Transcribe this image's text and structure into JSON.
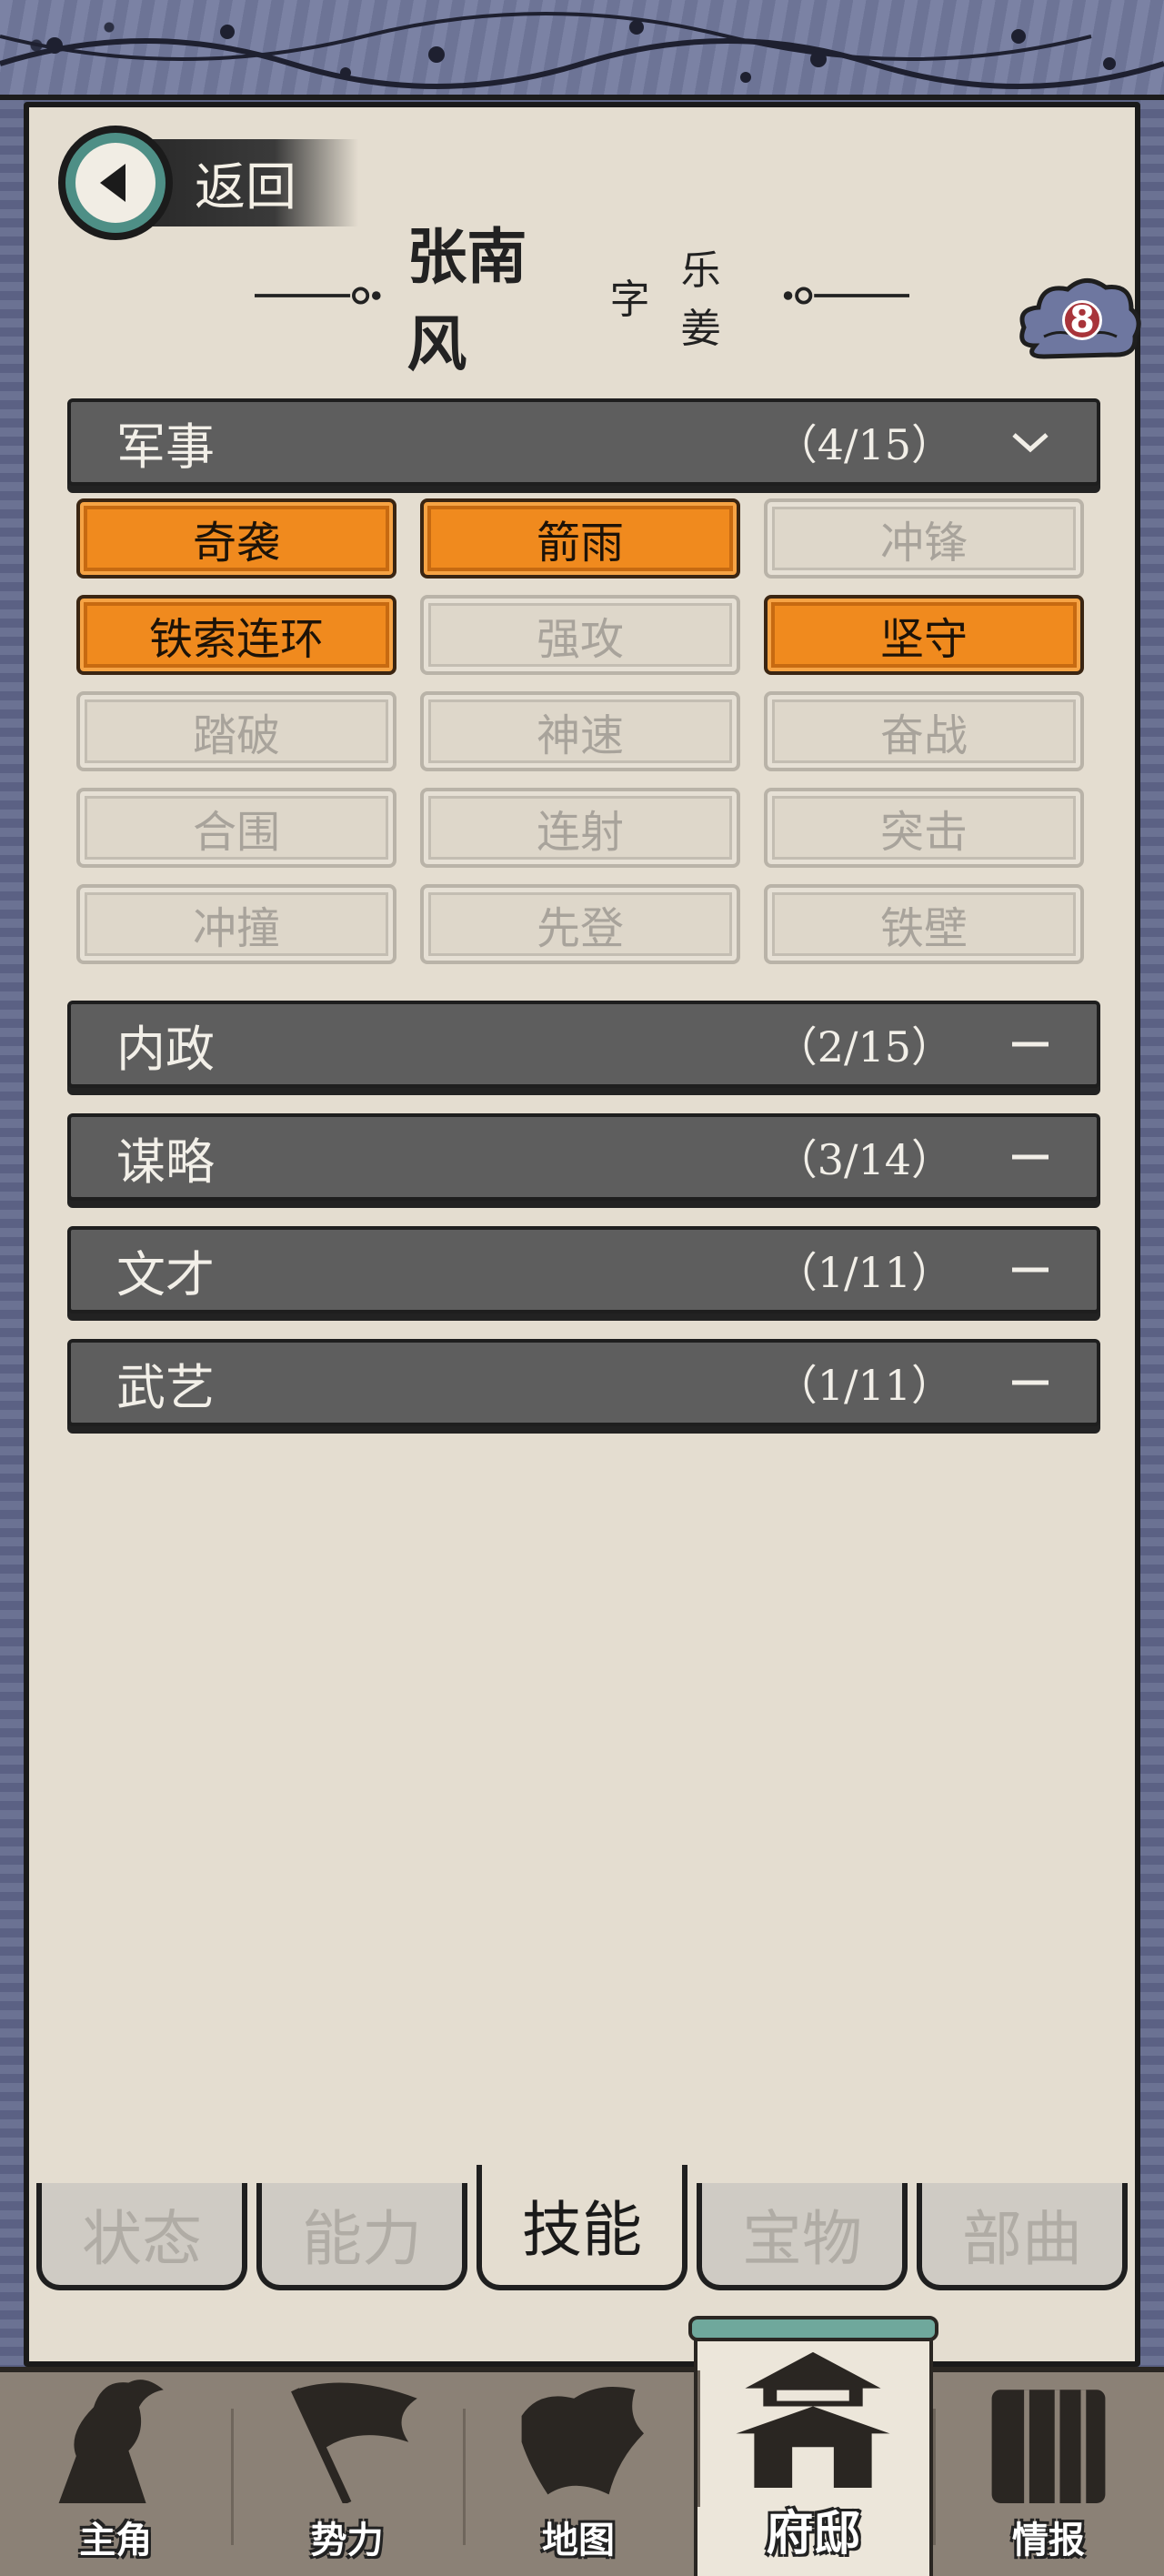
{
  "back": {
    "label": "返回"
  },
  "character": {
    "name": "张南风",
    "zi_label": "字",
    "courtesy_name": "乐姜"
  },
  "badge": {
    "count": "8"
  },
  "sections": [
    {
      "name": "军事",
      "count": "（4/15）",
      "expanded": true,
      "skills": [
        {
          "label": "奇袭",
          "learned": true
        },
        {
          "label": "箭雨",
          "learned": true
        },
        {
          "label": "冲锋",
          "learned": false
        },
        {
          "label": "铁索连环",
          "learned": true
        },
        {
          "label": "强攻",
          "learned": false
        },
        {
          "label": "坚守",
          "learned": true
        },
        {
          "label": "踏破",
          "learned": false
        },
        {
          "label": "神速",
          "learned": false
        },
        {
          "label": "奋战",
          "learned": false
        },
        {
          "label": "合围",
          "learned": false
        },
        {
          "label": "连射",
          "learned": false
        },
        {
          "label": "突击",
          "learned": false
        },
        {
          "label": "冲撞",
          "learned": false
        },
        {
          "label": "先登",
          "learned": false
        },
        {
          "label": "铁壁",
          "learned": false
        }
      ]
    },
    {
      "name": "内政",
      "count": "（2/15）",
      "expanded": false
    },
    {
      "name": "谋略",
      "count": "（3/14）",
      "expanded": false
    },
    {
      "name": "文才",
      "count": "（1/11）",
      "expanded": false
    },
    {
      "name": "武艺",
      "count": "（1/11）",
      "expanded": false
    }
  ],
  "tabs": [
    {
      "label": "状态",
      "active": false
    },
    {
      "label": "能力",
      "active": false
    },
    {
      "label": "技能",
      "active": true
    },
    {
      "label": "宝物",
      "active": false
    },
    {
      "label": "部曲",
      "active": false
    }
  ],
  "nav": [
    {
      "label": "主角",
      "icon": "warrior-icon",
      "active": false
    },
    {
      "label": "势力",
      "icon": "flag-icon",
      "active": false
    },
    {
      "label": "地图",
      "icon": "map-icon",
      "active": false
    },
    {
      "label": "府邸",
      "icon": "mansion-icon",
      "active": true
    },
    {
      "label": "情报",
      "icon": "scroll-icon",
      "active": false
    }
  ],
  "colors": {
    "learned_skill": "#f08a1e",
    "section_header": "#5e5e5e",
    "parchment": "#e4ddd0",
    "back_button": "#4e8f86",
    "badge": "#a8343a"
  }
}
